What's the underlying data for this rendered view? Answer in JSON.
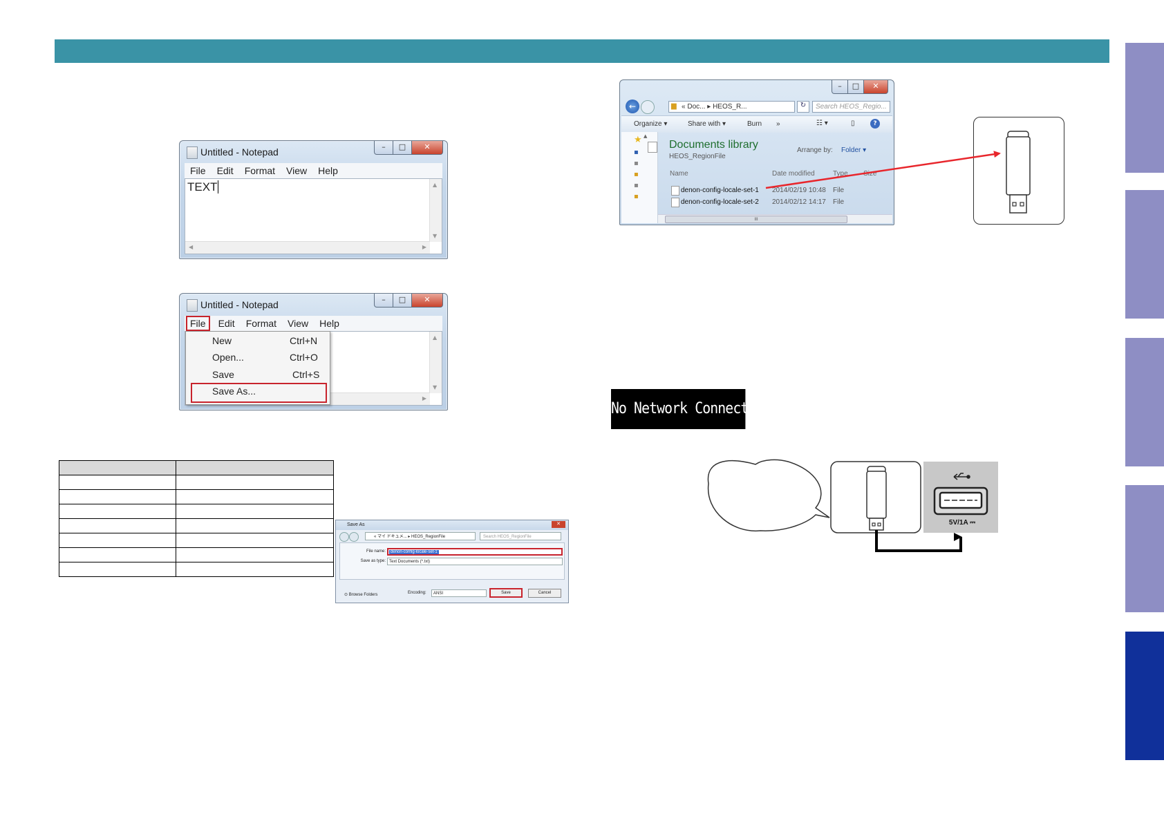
{
  "header": {
    "color": "#3a93a6"
  },
  "side_tabs": {
    "colors": [
      "#8e8ec4",
      "#8e8ec4",
      "#8e8ec4",
      "#8e8ec4",
      "#10309a"
    ]
  },
  "notepad1": {
    "title": "Untitled - Notepad",
    "menu": [
      "File",
      "Edit",
      "Format",
      "View",
      "Help"
    ],
    "content": "TEXT"
  },
  "notepad2": {
    "title": "Untitled - Notepad",
    "menu": [
      "File",
      "Edit",
      "Format",
      "View",
      "Help"
    ],
    "file_menu": [
      {
        "label": "New",
        "shortcut": "Ctrl+N"
      },
      {
        "label": "Open...",
        "shortcut": "Ctrl+O"
      },
      {
        "label": "Save",
        "shortcut": "Ctrl+S"
      },
      {
        "label": "Save As...",
        "shortcut": ""
      }
    ]
  },
  "save_as": {
    "title": "Save As",
    "path": [
      "«",
      "マイ ドキュメ...",
      "▸",
      "HEOS_RegionFile"
    ],
    "search_placeholder": "Search HEOS_RegionFile",
    "file_name_label": "File name:",
    "file_name_value": "denon-config-locale-set-1",
    "save_type_label": "Save as type:",
    "save_type_value": "Text Documents (*.txt)",
    "browse_label": "Browse Folders",
    "encoding_label": "Encoding:",
    "encoding_value": "ANSI",
    "save_button": "Save",
    "cancel_button": "Cancel"
  },
  "explorer": {
    "path": [
      "«",
      "Doc...",
      "▸",
      "HEOS_R..."
    ],
    "search_placeholder": "Search HEOS_Regio...",
    "toolbar": [
      "Organize ▾",
      "Share with ▾",
      "Burn",
      "»"
    ],
    "library_title": "Documents library",
    "library_subtitle": "HEOS_RegionFile",
    "arrange_label": "Arrange by:",
    "arrange_value": "Folder ▾",
    "columns": [
      "Name",
      "Date modified",
      "Type",
      "Size"
    ],
    "files": [
      {
        "name": "denon-config-locale-set-1",
        "date": "2014/02/19 10:48",
        "type": "File"
      },
      {
        "name": "denon-config-locale-set-2",
        "date": "2014/02/12 14:17",
        "type": "File"
      }
    ],
    "hscroll_label": "III"
  },
  "display": {
    "text": "No Network Connection"
  },
  "usb_port": {
    "label": "5V/1A ⎓",
    "symbol": "⭠"
  },
  "table": {
    "rows": 8
  }
}
